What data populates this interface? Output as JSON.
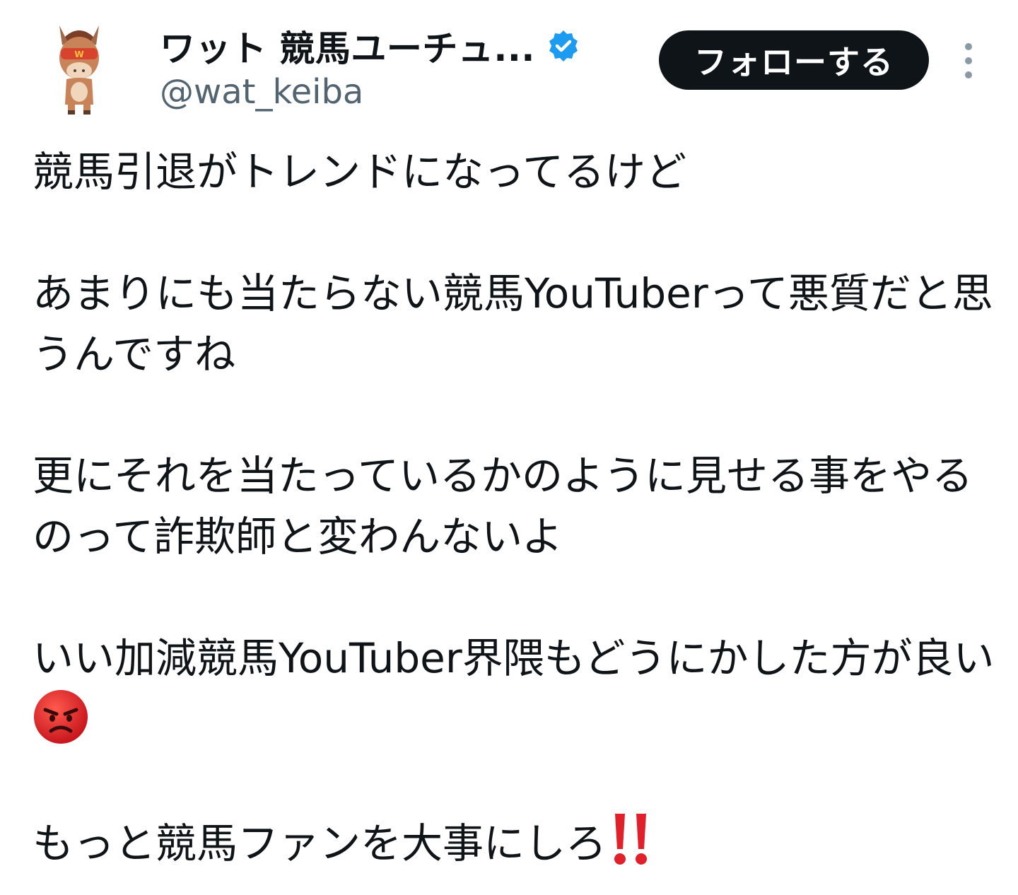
{
  "author": {
    "display_name": "ワット 競馬ユーチュ...",
    "handle": "@wat_keiba",
    "verified": true,
    "avatar_icon": "horse-mascot-avatar"
  },
  "actions": {
    "follow_label": "フォローする",
    "more_icon": "more-vertical-icon"
  },
  "tweet": {
    "paragraphs": [
      "競馬引退がトレンドになってるけど",
      "あまりにも当たらない競馬YouTuberって悪質だと思うんですね",
      "更にそれを当たっているかのように見せる事をやるのって詐欺師と変わんないよ",
      "いい加減競馬YouTuber界隈もどうにかした方が良い",
      "もっと競馬ファンを大事にしろ"
    ],
    "emoji_after_para4": "pouting-face-emoji",
    "emoji_after_para5": "double-exclamation-emoji"
  },
  "colors": {
    "text": "#0f1419",
    "secondary": "#536471",
    "button_bg": "#0f1419",
    "verified_blue": "#1d9bf0"
  }
}
